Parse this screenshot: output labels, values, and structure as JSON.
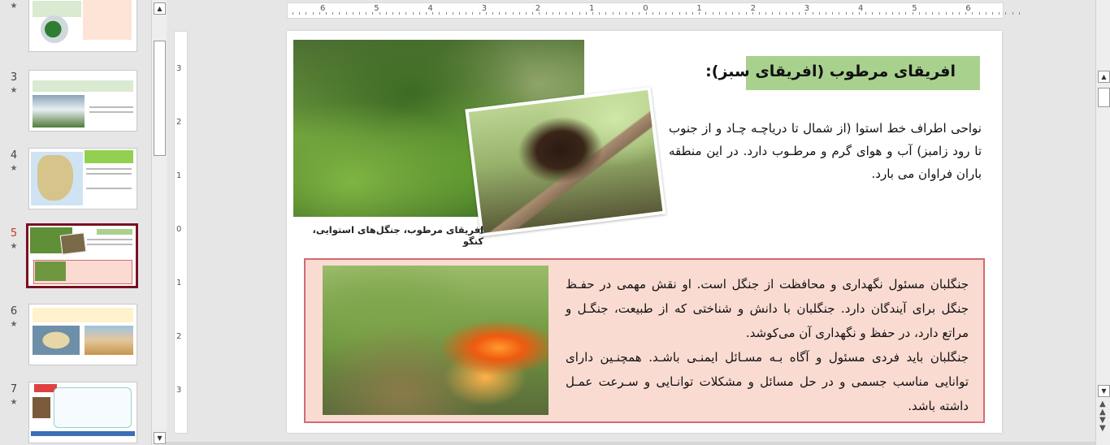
{
  "thumbnails": [
    {
      "num": "",
      "star": "★",
      "active": false
    },
    {
      "num": "3",
      "star": "★",
      "active": false
    },
    {
      "num": "4",
      "star": "★",
      "active": false
    },
    {
      "num": "5",
      "star": "★",
      "active": true
    },
    {
      "num": "6",
      "star": "★",
      "active": false
    },
    {
      "num": "7",
      "star": "★",
      "active": false
    }
  ],
  "ruler": {
    "h": [
      "6",
      "5",
      "4",
      "3",
      "2",
      "1",
      "0",
      "1",
      "2",
      "3",
      "4",
      "5",
      "6"
    ],
    "v": [
      "3",
      "2",
      "1",
      "0",
      "1",
      "2",
      "3"
    ]
  },
  "slide": {
    "title": "افریقای مرطوب (افریقای سبز):",
    "caption": "افریقای مرطوب، جنگل‌های استوایی، کنگو",
    "para1": "نواحی اطراف خط استوا (از شمال تا دریاچـه چـاد و از جنوب تا رود زامبز) آب و هوای گرم و مرطـوب دارد. در این منطقه باران فراوان می بارد.",
    "para2a": "جنگلبان مسئول نگهداری و محافظت از جنگل است. او نقش مهمی در حفـظ جنگل برای آیندگان دارد. جنگلبان با دانش و شناختی که از طبیعت، جنگـل و مراتع دارد، در حفظ و نگهداری آن می‌کوشد.",
    "para2b": "جنگلبان باید فردی مسئول و آگاه بـه مسـائل ایمنـی باشـد. همچنـین دارای توانایی مناسب جسمی و در حل مسائل و مشکلات توانـایی و سـرعت عمـل داشته باشد."
  },
  "colors": {
    "title_bg": "#a9d18e",
    "box_bg": "#fadbd2",
    "box_border": "#d46a72",
    "active_thumb": "#7a1020"
  }
}
